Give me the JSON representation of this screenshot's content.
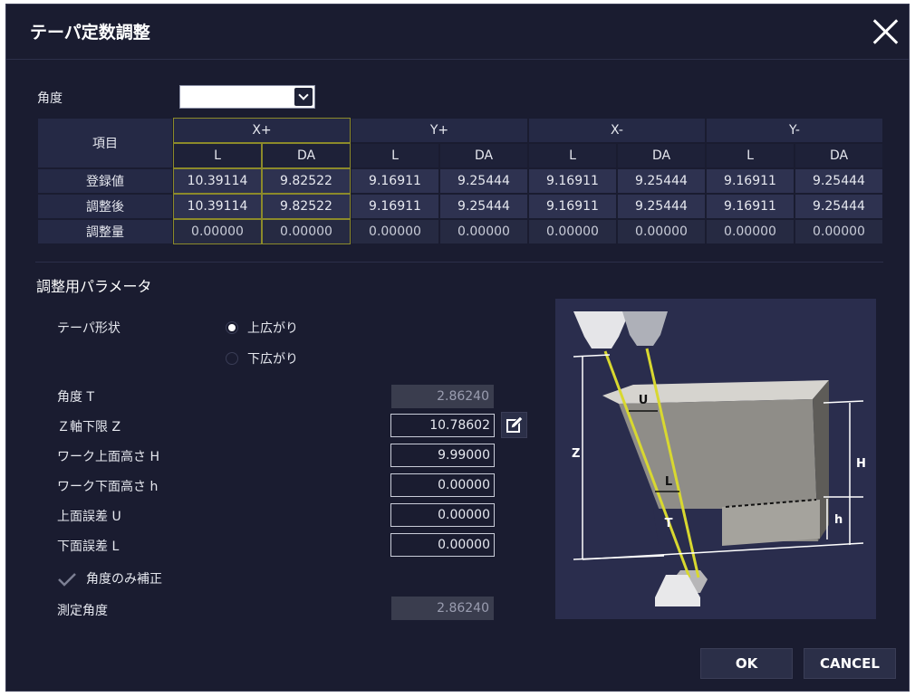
{
  "dialog": {
    "title": "テーパ定数調整",
    "close_icon": "close-icon"
  },
  "angle": {
    "label": "角度",
    "selected_value": ""
  },
  "table": {
    "item_header": "項目",
    "groups": [
      "X+",
      "Y+",
      "X-",
      "Y-"
    ],
    "sub_headers": [
      "L",
      "DA",
      "L",
      "DA",
      "L",
      "DA",
      "L",
      "DA"
    ],
    "rows": [
      {
        "label": "登録値",
        "values": [
          "10.39114",
          "9.82522",
          "9.16911",
          "9.25444",
          "9.16911",
          "9.25444",
          "9.16911",
          "9.25444"
        ]
      },
      {
        "label": "調整後",
        "values": [
          "10.39114",
          "9.82522",
          "9.16911",
          "9.25444",
          "9.16911",
          "9.25444",
          "9.16911",
          "9.25444"
        ]
      },
      {
        "label": "調整量",
        "values": [
          "0.00000",
          "0.00000",
          "0.00000",
          "0.00000",
          "0.00000",
          "0.00000",
          "0.00000",
          "0.00000"
        ]
      }
    ]
  },
  "params": {
    "section_title": "調整用パラメータ",
    "taper_shape_label": "テーパ形状",
    "radio_up_label": "上広がり",
    "radio_down_label": "下広がり",
    "selected_shape": "上広がり",
    "angle_t_label": "角度 T",
    "angle_t_value": "2.86240",
    "z_label": "Ｚ軸下限 Z",
    "z_value": "10.78602",
    "h_label": "ワーク上面高さ H",
    "h_value": "9.99000",
    "h_low_label": "ワーク下面高さ h",
    "h_low_value": "0.00000",
    "u_label": "上面誤差 U",
    "u_value": "0.00000",
    "l_label": "下面誤差 L",
    "l_value": "0.00000",
    "angle_only_label": "角度のみ補正",
    "angle_only_checked": true,
    "measured_angle_label": "測定角度",
    "measured_angle_value": "2.86240",
    "edit_icon": "edit-pencil-icon"
  },
  "figure": {
    "label_u": "U",
    "label_l": "L",
    "label_t": "T",
    "label_z": "Z",
    "label_h_upper": "H",
    "label_h_lower": "h"
  },
  "buttons": {
    "ok": "OK",
    "cancel": "CANCEL"
  },
  "colors": {
    "background": "#1a1c30",
    "table_value": "#2e3250",
    "wire": "#d8d830",
    "highlight_border": "#8c8a2a"
  }
}
